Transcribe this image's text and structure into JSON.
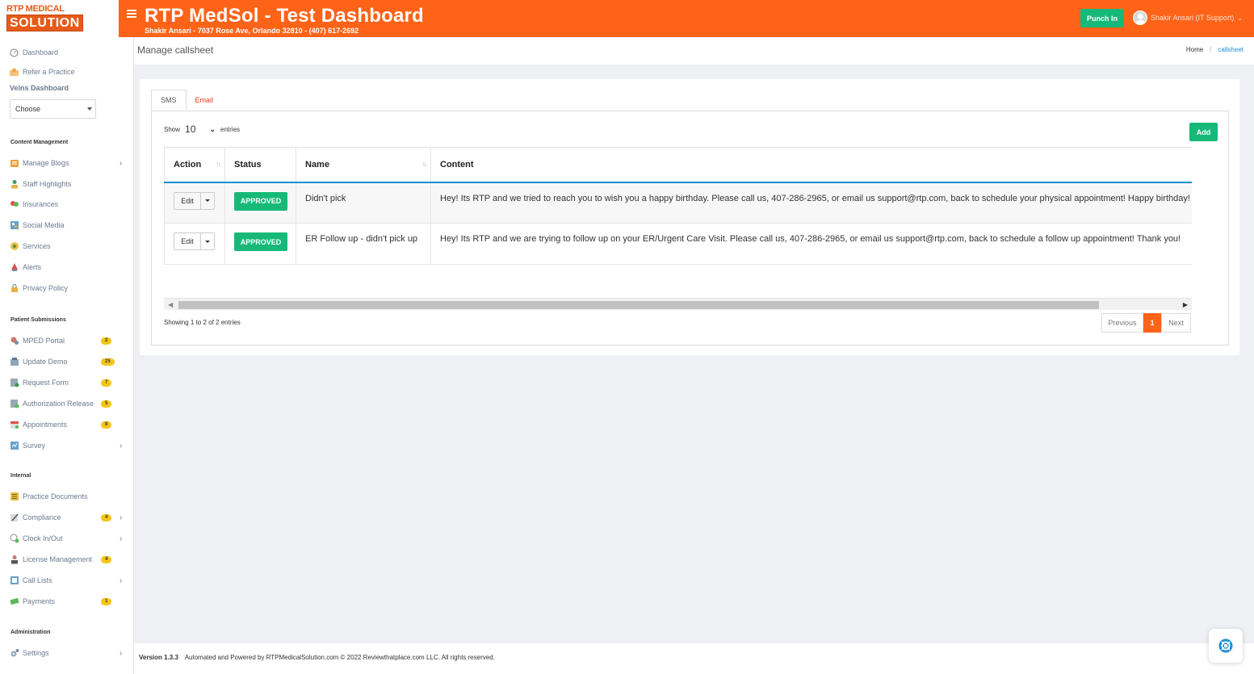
{
  "brand": {
    "logo_top": "RTP MEDICAL",
    "logo_bottom": "SOLUTION",
    "accent": "#ff6318",
    "green": "#17b978"
  },
  "header": {
    "title": "RTP MedSol - Test Dashboard",
    "subtitle": "Shakir Ansari - 7037 Rose Ave, Orlando 32810 - (407) 617-2692",
    "punch_label": "Punch In",
    "user_name": "Shakir Ansari (IT Support)"
  },
  "sidebar": {
    "dashboard": "Dashboard",
    "refer": "Refer a Practice",
    "veins_label": "Veins Dashboard",
    "veins_select": "Choose",
    "content_section": "Content Management",
    "content_items": [
      {
        "label": "Manage Blogs",
        "icon": "blog-icon"
      },
      {
        "label": "Staff Highlights",
        "icon": "staff-icon"
      },
      {
        "label": "Insurances",
        "icon": "insurance-icon"
      },
      {
        "label": "Social Media",
        "icon": "social-icon"
      },
      {
        "label": "Services",
        "icon": "services-icon"
      },
      {
        "label": "Alerts",
        "icon": "alert-icon"
      },
      {
        "label": "Privacy Policy",
        "icon": "lock-icon"
      }
    ],
    "patient_section": "Patient Submissions",
    "patient_items": [
      {
        "label": "MPED Portal",
        "badge": "2"
      },
      {
        "label": "Update Demo",
        "badge": "25"
      },
      {
        "label": "Request Form",
        "badge": "7"
      },
      {
        "label": "Authorization Release",
        "badge": "5"
      },
      {
        "label": "Appointments",
        "badge": "8"
      },
      {
        "label": "Survey"
      }
    ],
    "internal_section": "Internal",
    "internal_items": [
      {
        "label": "Practice Documents"
      },
      {
        "label": "Compliance",
        "badge": "4"
      },
      {
        "label": "Clock In/Out"
      },
      {
        "label": "License Management",
        "badge": "4"
      },
      {
        "label": "Call Lists"
      },
      {
        "label": "Payments",
        "badge": "1"
      }
    ],
    "admin_section": "Administration",
    "admin_items": [
      {
        "label": "Settings"
      }
    ]
  },
  "page": {
    "title": "Manage callsheet",
    "breadcrumb": [
      "Home",
      "callsheet"
    ]
  },
  "tabs": [
    "SMS",
    "Email"
  ],
  "toolbar": {
    "add_label": "Add",
    "show_label": "Show",
    "length": "10",
    "entries_label": "entries"
  },
  "table": {
    "columns": [
      "Action",
      "Status",
      "Name",
      "Content"
    ],
    "rows": [
      {
        "action": "Edit",
        "status": "APPROVED",
        "name": "Didn't pick",
        "content": "Hey! Its RTP and we tried to reach you to wish you a happy birthday. Please call us, 407-286-2965, or email us support@rtp.com, back to schedule your physical appointment! Happy birthday!"
      },
      {
        "action": "Edit",
        "status": "APPROVED",
        "name": "ER Follow up - didn't pick up",
        "content": "Hey! Its RTP and we are trying to follow up on your ER/Urgent Care Visit. Please call us, 407-286-2965, or email us support@rtp.com, back to schedule a follow up appointment! Thank you!"
      }
    ],
    "info": "Showing 1 to 2 of 2 entries"
  },
  "pagination": {
    "prev": "Previous",
    "current": "1",
    "next": "Next"
  },
  "footer": {
    "version": "Version 1.3.3",
    "text": "Automated and Powered by RTPMedicalSolution.com © 2022 Reviewthatplace.com LLC. All rights reserved."
  }
}
